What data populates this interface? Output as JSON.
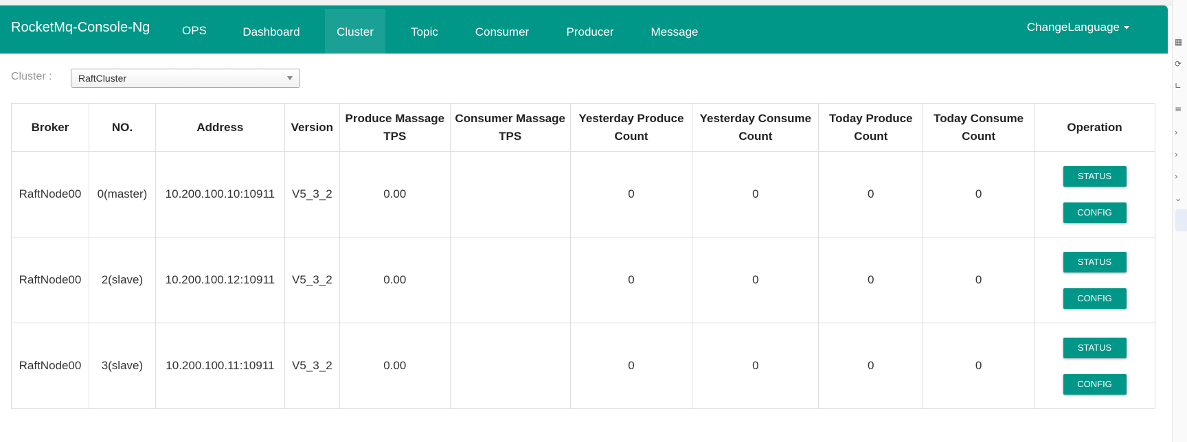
{
  "nav": {
    "brand": "RocketMq-Console-Ng",
    "items": [
      "OPS",
      "Dashboard",
      "Cluster",
      "Topic",
      "Consumer",
      "Producer",
      "Message"
    ],
    "active": "Cluster",
    "language": "ChangeLanguage"
  },
  "filter": {
    "label": "Cluster :",
    "selected": "RaftCluster"
  },
  "table": {
    "headers": [
      "Broker",
      "NO.",
      "Address",
      "Version",
      "Produce Massage TPS",
      "Consumer Massage TPS",
      "Yesterday Produce Count",
      "Yesterday Consume Count",
      "Today Produce Count",
      "Today Consume Count",
      "Operation"
    ],
    "rows": [
      {
        "broker": "RaftNode00",
        "no": "0(master)",
        "address": "10.200.100.10:10911",
        "version": "V5_3_2",
        "produce_tps": "0.00",
        "consumer_tps": "",
        "yesterday_produce": "0",
        "yesterday_consume": "0",
        "today_produce": "0",
        "today_consume": "0"
      },
      {
        "broker": "RaftNode00",
        "no": "2(slave)",
        "address": "10.200.100.12:10911",
        "version": "V5_3_2",
        "produce_tps": "0.00",
        "consumer_tps": "",
        "yesterday_produce": "0",
        "yesterday_consume": "0",
        "today_produce": "0",
        "today_consume": "0"
      },
      {
        "broker": "RaftNode00",
        "no": "3(slave)",
        "address": "10.200.100.11:10911",
        "version": "V5_3_2",
        "produce_tps": "0.00",
        "consumer_tps": "",
        "yesterday_produce": "0",
        "yesterday_consume": "0",
        "today_produce": "0",
        "today_consume": "0"
      }
    ],
    "status_label": "STATUS",
    "config_label": "CONFIG"
  },
  "colors": {
    "primary": "#009688"
  }
}
